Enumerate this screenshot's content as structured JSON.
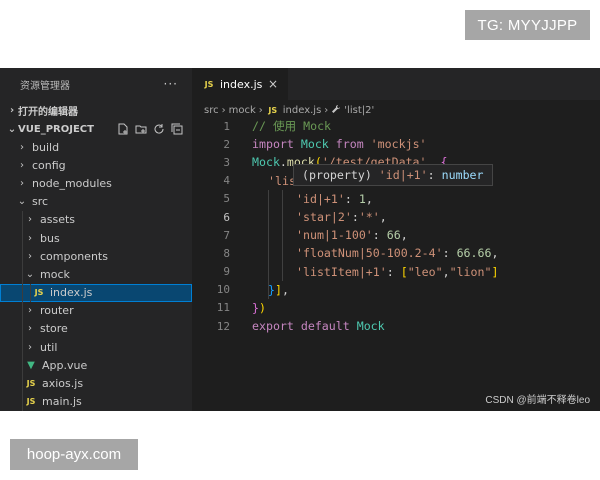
{
  "overlays": {
    "tg_label": "TG: MYYJJPP",
    "site_label": "hoop-ayx.com",
    "watermark": "CSDN @前端不释卷leo"
  },
  "sidebar": {
    "title": "资源管理器",
    "more": "···",
    "open_editors": "打开的编辑器",
    "project": "VUE_PROJECT",
    "tree": [
      {
        "label": "build",
        "depth": 0,
        "type": "folder",
        "expanded": false
      },
      {
        "label": "config",
        "depth": 0,
        "type": "folder",
        "expanded": false
      },
      {
        "label": "node_modules",
        "depth": 0,
        "type": "folder",
        "expanded": false
      },
      {
        "label": "src",
        "depth": 0,
        "type": "folder",
        "expanded": true
      },
      {
        "label": "assets",
        "depth": 1,
        "type": "folder",
        "expanded": false
      },
      {
        "label": "bus",
        "depth": 1,
        "type": "folder",
        "expanded": false
      },
      {
        "label": "components",
        "depth": 1,
        "type": "folder",
        "expanded": false
      },
      {
        "label": "mock",
        "depth": 1,
        "type": "folder",
        "expanded": true
      },
      {
        "label": "index.js",
        "depth": 2,
        "type": "js",
        "active": true
      },
      {
        "label": "router",
        "depth": 1,
        "type": "folder",
        "expanded": false
      },
      {
        "label": "store",
        "depth": 1,
        "type": "folder",
        "expanded": false
      },
      {
        "label": "util",
        "depth": 1,
        "type": "folder",
        "expanded": false
      },
      {
        "label": "App.vue",
        "depth": 1,
        "type": "vue"
      },
      {
        "label": "axios.js",
        "depth": 1,
        "type": "js"
      },
      {
        "label": "main.js",
        "depth": 1,
        "type": "js"
      }
    ]
  },
  "editor": {
    "tab": {
      "icon": "JS",
      "label": "index.js",
      "close": "×"
    },
    "breadcrumb": {
      "p1": "src",
      "p2": "mock",
      "icon": "JS",
      "p3": "index.js",
      "p4": "'list|2'"
    },
    "hover": {
      "open": "(property) ",
      "name": "'id|+1'",
      "colon": ": ",
      "type": "number"
    },
    "line_numbers": [
      "1",
      "2",
      "3",
      "4",
      "5",
      "6",
      "7",
      "8",
      "9",
      "10",
      "11",
      "12"
    ],
    "code": {
      "l1": {
        "comment": "// 使用 Mock"
      },
      "l2": {
        "kw1": "import",
        "var": " Mock",
        "kw2": " from",
        "str": " 'mockjs'"
      },
      "l3": {
        "var": "Mock",
        "dot": ".",
        "fn": "mock",
        "brk": "(",
        "str": "'/test/getData'",
        "comma": ", ",
        "brace": "{"
      },
      "l4": {
        "str": "'lis"
      },
      "l5": {
        "key": "'id|+1'",
        "colon": ": ",
        "num": "1",
        "comma": ","
      },
      "l6": {
        "key": "'star|2'",
        "colon": ":",
        "str": "'*'",
        "comma": ","
      },
      "l7": {
        "key": "'num|1-100'",
        "colon": ": ",
        "num": "66",
        "comma": ","
      },
      "l8": {
        "key": "'floatNum|50-100.2-4'",
        "colon": ": ",
        "num": "66.66",
        "comma": ","
      },
      "l9": {
        "key": "'listItem|+1'",
        "colon": ": ",
        "b1": "[",
        "s1": "\"leo\"",
        "comma": ",",
        "s2": "\"lion\"",
        "b2": "]"
      },
      "l10": {
        "b": "}",
        "b2": "]",
        "comma": ","
      },
      "l11": {
        "b": "}",
        "p": ")"
      },
      "l12": {
        "kw1": "export",
        "kw2": " default",
        "var": " Mock"
      }
    }
  }
}
